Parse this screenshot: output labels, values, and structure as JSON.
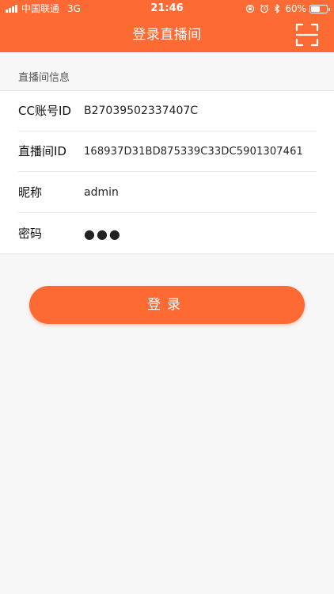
{
  "status_bar": {
    "carrier": "中国联通",
    "network": "3G",
    "time": "21:46",
    "battery_percent": "60%",
    "battery_level": 0.6
  },
  "nav": {
    "title": "登录直播间",
    "scan_icon": "scan-icon"
  },
  "section": {
    "title": "直播间信息"
  },
  "form": {
    "rows": [
      {
        "label": "CC账号ID",
        "value": "B27039502337407C"
      },
      {
        "label": "直播间ID",
        "value": "168937D31BD875339C33DC5901307461"
      },
      {
        "label": "昵称",
        "value": "admin"
      },
      {
        "label": "密码",
        "value": "●●●"
      }
    ]
  },
  "login_button": {
    "label": "登录"
  },
  "colors": {
    "accent": "#fd6a34",
    "background": "#f7f7f7"
  }
}
